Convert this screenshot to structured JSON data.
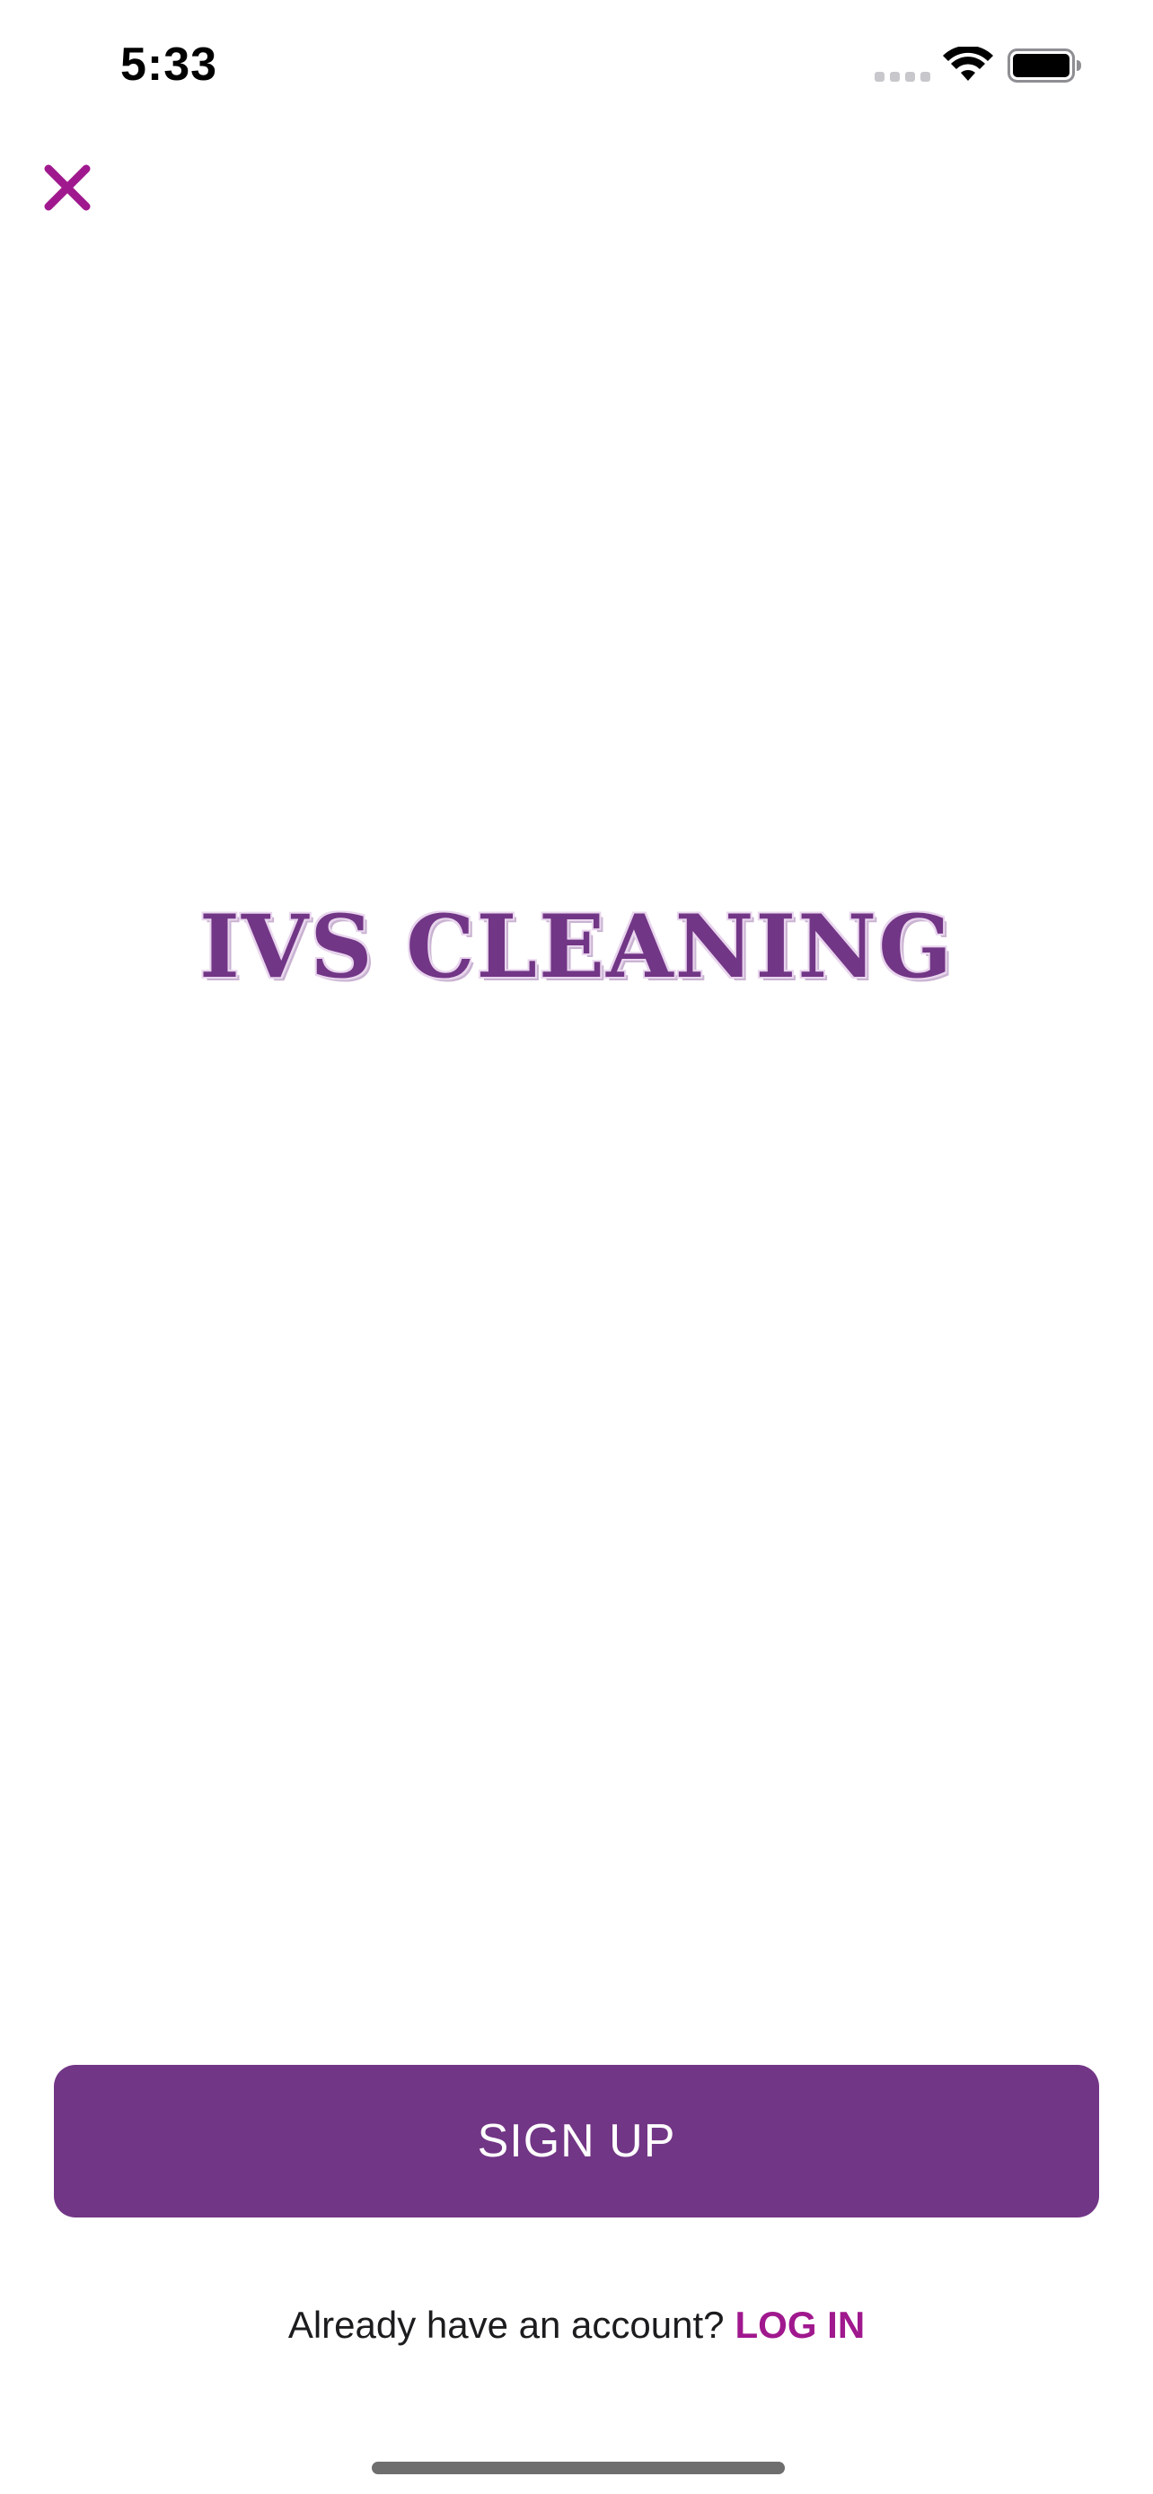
{
  "status_bar": {
    "time": "5:33"
  },
  "header": {
    "close_icon": "close-icon"
  },
  "logo": {
    "text": "IVS CLEANING"
  },
  "actions": {
    "signup_label": "SIGN UP",
    "login_prompt": "Already have an account?",
    "login_label": "LOG IN"
  },
  "colors": {
    "brand_purple": "#723686",
    "link_magenta": "#a0188e",
    "background": "#ffffff"
  }
}
